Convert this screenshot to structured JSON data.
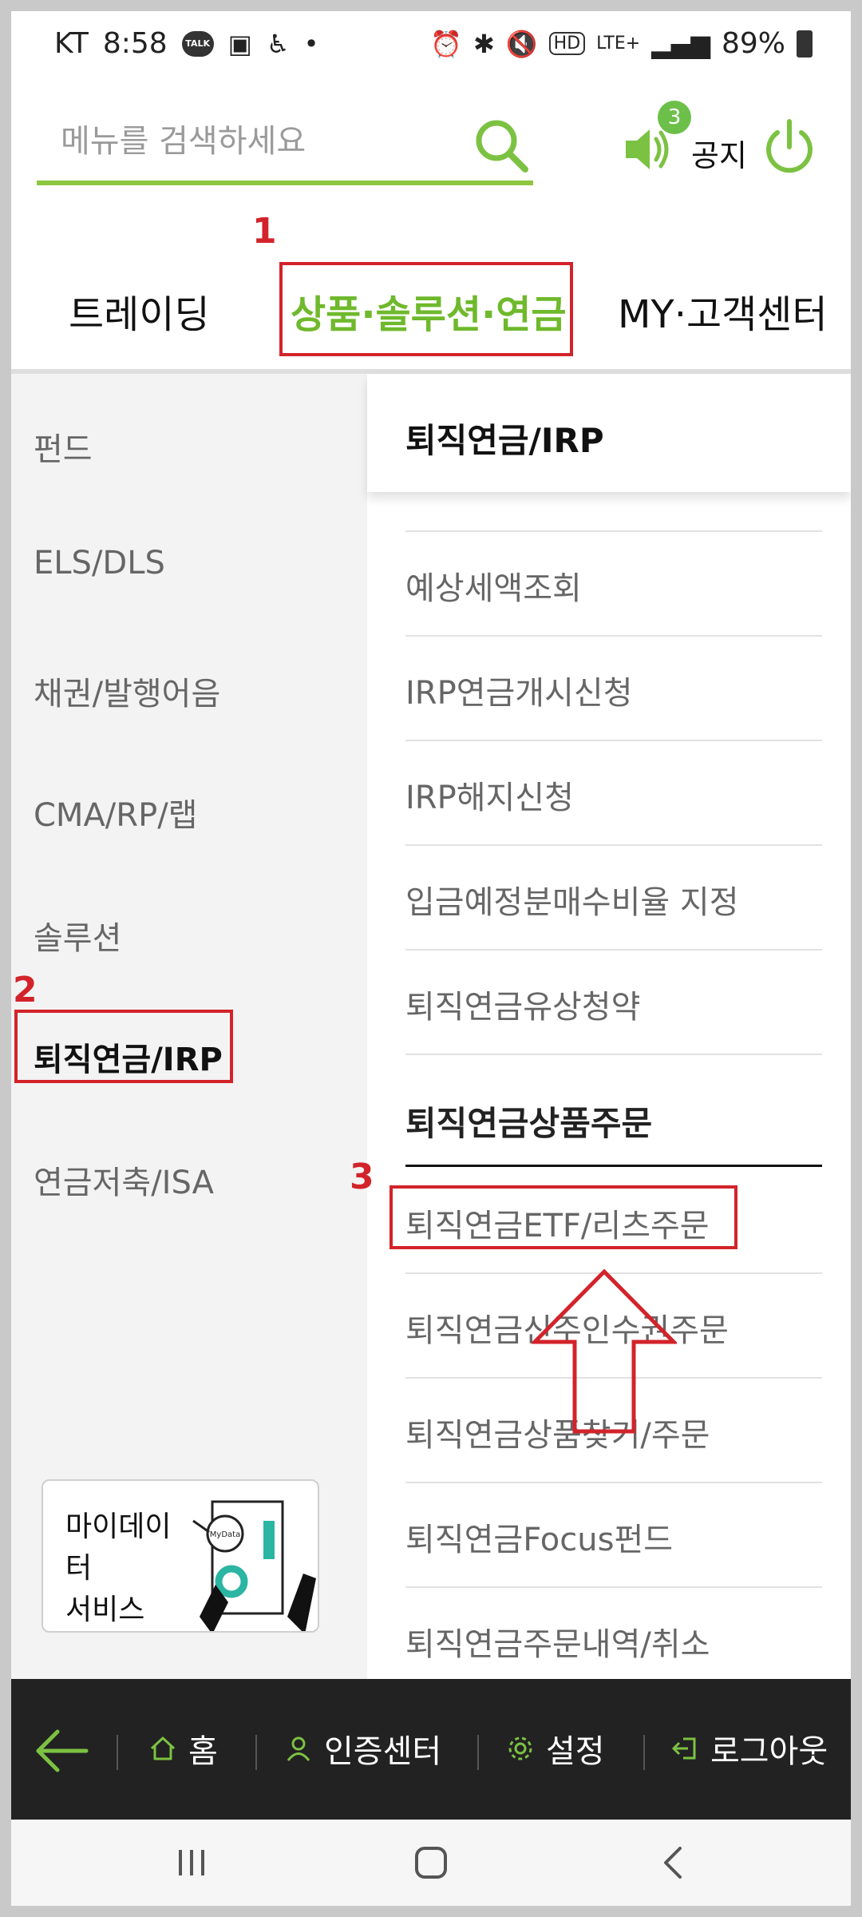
{
  "status_bar": {
    "carrier": "KT",
    "time": "8:58",
    "talk_badge": "TALK",
    "hd": "HD",
    "network": "LTE+",
    "battery": "89%"
  },
  "header": {
    "search_placeholder": "메뉴를 검색하세요",
    "notice_badge_count": "3",
    "notice_label": "공지"
  },
  "tabs": [
    {
      "label": "트레이딩"
    },
    {
      "label": "상품·솔루션·연금"
    },
    {
      "label": "MY·고객센터"
    }
  ],
  "annotations": [
    "1",
    "2",
    "3"
  ],
  "left_menu": [
    {
      "label": "펀드"
    },
    {
      "label": "ELS/DLS"
    },
    {
      "label": "채권/발행어음"
    },
    {
      "label": "CMA/RP/랩"
    },
    {
      "label": "솔루션"
    },
    {
      "label": "퇴직연금/IRP"
    },
    {
      "label": "연금저축/ISA"
    }
  ],
  "mydata": {
    "line1": "마이데이터",
    "line2": "서비스",
    "tag": "MyData"
  },
  "right_panel": {
    "title": "퇴직연금/IRP",
    "items": [
      {
        "label": "예상세액조회"
      },
      {
        "label": "IRP연금개시신청"
      },
      {
        "label": "IRP해지신청"
      },
      {
        "label": "입금예정분매수비율 지정"
      },
      {
        "label": "퇴직연금유상청약"
      }
    ],
    "section_title": "퇴직연금상품주문",
    "section_items": [
      {
        "label": "퇴직연금ETF/리츠주문"
      },
      {
        "label": "퇴직연금신주인수권주문"
      },
      {
        "label": "퇴직연금상품찾기/주문"
      },
      {
        "label": "퇴직연금Focus펀드"
      },
      {
        "label": "퇴직연금주문내역/취소"
      }
    ]
  },
  "bottom_nav": {
    "home": "홈",
    "cert": "인증센터",
    "settings": "설정",
    "logout": "로그아웃"
  },
  "colors": {
    "accent": "#8dc63f",
    "annotation_red": "#d3232a",
    "nav_bg": "#222222"
  }
}
